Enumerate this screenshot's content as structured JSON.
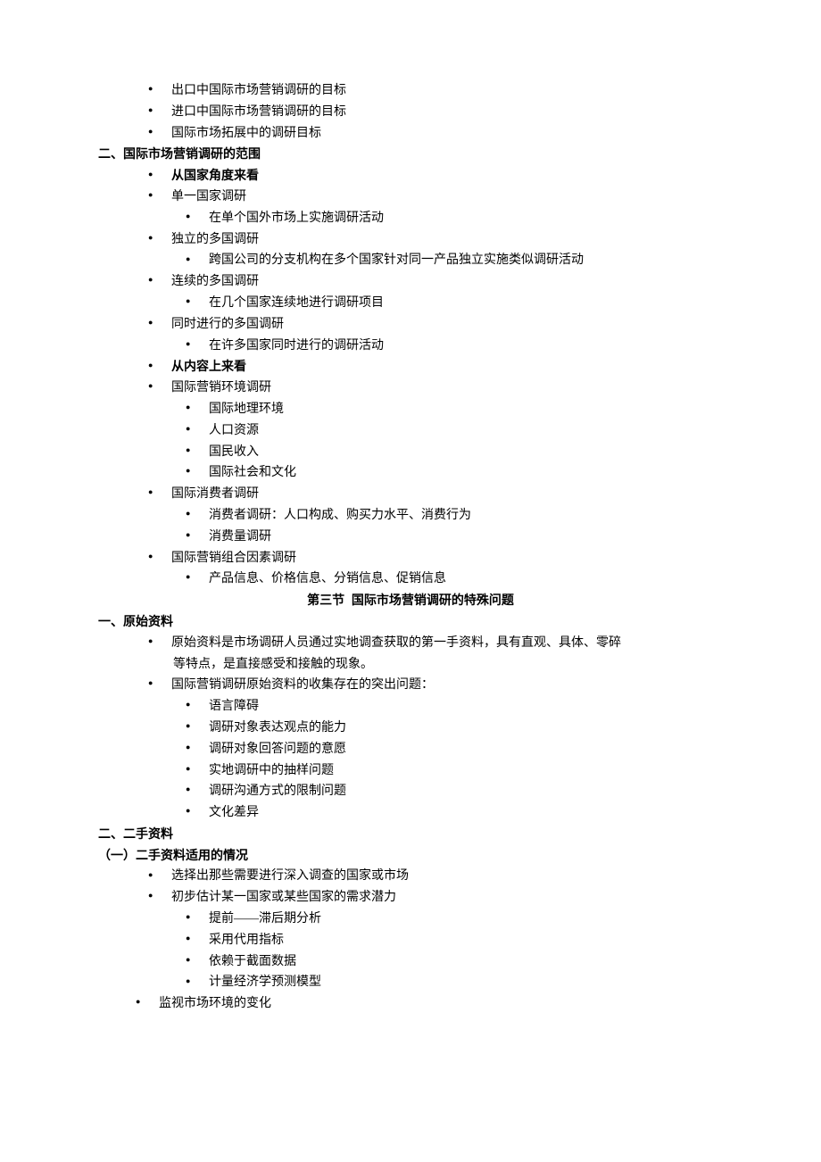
{
  "lines": [
    {
      "cls": "bul ind1",
      "t": "出口中国际市场营销调研的目标"
    },
    {
      "cls": "bul ind1",
      "t": "进口中国际市场营销调研的目标"
    },
    {
      "cls": "bul ind1",
      "t": "国际市场拓展中的调研目标"
    },
    {
      "cls": "bold h0",
      "t": "二、国际市场营销调研的范围"
    },
    {
      "cls": "bul ind1 bold",
      "t": "从国家角度来看"
    },
    {
      "cls": "bul ind1",
      "t": "单一国家调研"
    },
    {
      "cls": "bul ind2",
      "t": "在单个国外市场上实施调研活动"
    },
    {
      "cls": "bul ind1",
      "t": "独立的多国调研"
    },
    {
      "cls": "bul ind2",
      "t": "跨国公司的分支机构在多个国家针对同一产品独立实施类似调研活动"
    },
    {
      "cls": "bul ind1",
      "t": "连续的多国调研"
    },
    {
      "cls": "bul ind2",
      "t": "在几个国家连续地进行调研项目"
    },
    {
      "cls": "bul ind1",
      "t": "同时进行的多国调研"
    },
    {
      "cls": "bul ind2",
      "t": "在许多国家同时进行的调研活动"
    },
    {
      "cls": "bul ind1 bold",
      "t": "从内容上来看"
    },
    {
      "cls": "bul ind1",
      "t": "国际营销环境调研"
    },
    {
      "cls": "bul ind2",
      "t": "国际地理环境"
    },
    {
      "cls": "bul ind2",
      "t": "人口资源"
    },
    {
      "cls": "bul ind2",
      "t": "国民收入"
    },
    {
      "cls": "bul ind2",
      "t": "国际社会和文化"
    },
    {
      "cls": "bul ind1",
      "t": "国际消费者调研"
    },
    {
      "cls": "bul ind2",
      "t": "消费者调研：人口构成、购买力水平、消费行为"
    },
    {
      "cls": "bul ind2",
      "t": "消费量调研"
    },
    {
      "cls": "bul ind1",
      "t": "国际营销组合因素调研"
    },
    {
      "cls": "bul ind2",
      "t": "产品信息、价格信息、分销信息、促销信息"
    },
    {
      "cls": "sectiontitle",
      "t": "第三节  国际市场营销调研的特殊问题"
    },
    {
      "cls": "bold h0",
      "t": "一、原始资料"
    },
    {
      "cls": "bul ind1",
      "t": "原始资料是市场调研人员通过实地调查获取的第一手资料，具有直观、具体、零碎"
    },
    {
      "cls": "ind1",
      "t": "　　等特点，是直接感受和接触的现象。"
    },
    {
      "cls": "bul ind1",
      "t": "国际营销调研原始资料的收集存在的突出问题："
    },
    {
      "cls": "bul ind2",
      "t": "语言障碍"
    },
    {
      "cls": "bul ind2",
      "t": "调研对象表达观点的能力"
    },
    {
      "cls": "bul ind2",
      "t": "调研对象回答问题的意愿"
    },
    {
      "cls": "bul ind2",
      "t": "实地调研中的抽样问题"
    },
    {
      "cls": "bul ind2",
      "t": "调研沟通方式的限制问题"
    },
    {
      "cls": "bul ind2",
      "t": "文化差异"
    },
    {
      "cls": "bold h0",
      "t": "二、二手资料"
    },
    {
      "cls": "bold h0",
      "t": "（一）二手资料适用的情况"
    },
    {
      "cls": "bul ind1",
      "t": "选择出那些需要进行深入调查的国家或市场"
    },
    {
      "cls": "bul ind1",
      "t": "初步估计某一国家或某些国家的需求潜力"
    },
    {
      "cls": "bul ind2",
      "t": "提前——滞后期分析"
    },
    {
      "cls": "bul ind2",
      "t": "采用代用指标"
    },
    {
      "cls": "bul ind2",
      "t": "依赖于截面数据"
    },
    {
      "cls": "bul ind2",
      "t": "计量经济学预测模型"
    },
    {
      "cls": "bul ind3",
      "t": "监视市场环境的变化"
    }
  ]
}
